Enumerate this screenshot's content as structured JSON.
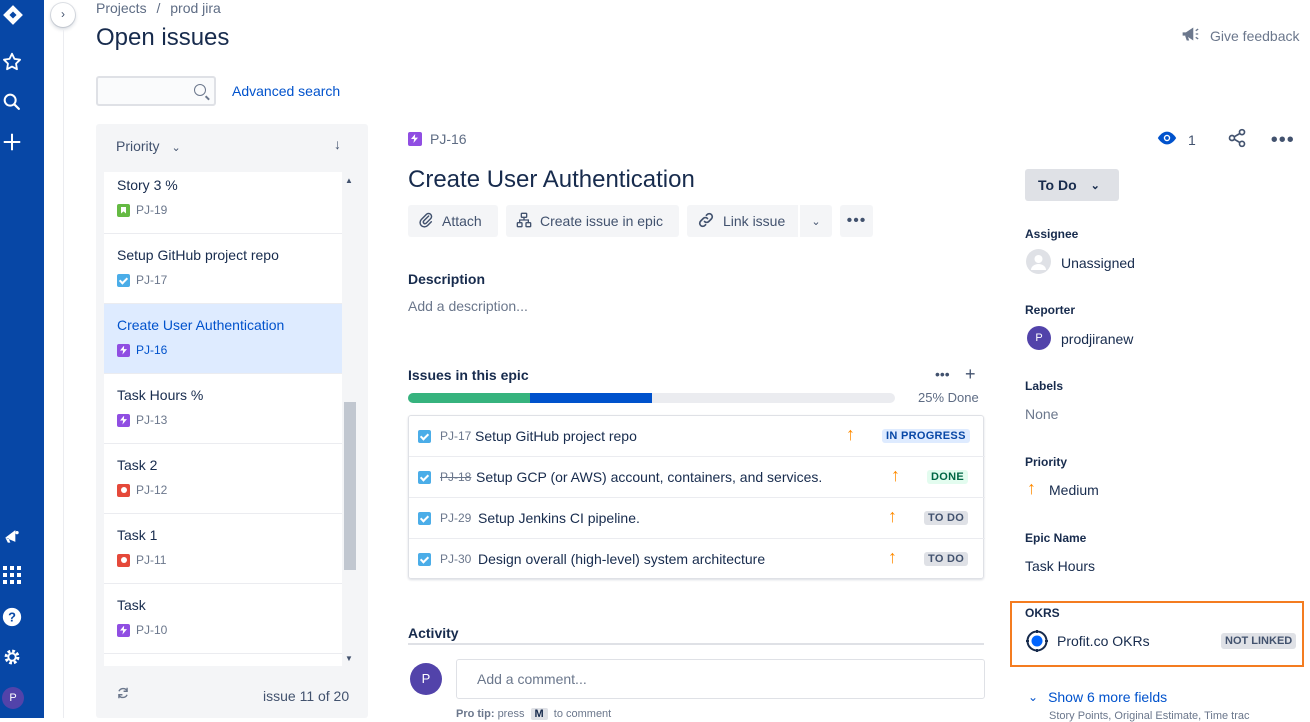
{
  "breadcrumb": {
    "projects": "Projects",
    "separator": "/",
    "project": "prod jira"
  },
  "page_title": "Open issues",
  "feedback_label": "Give feedback",
  "search": {
    "placeholder": "",
    "advanced_label": "Advanced search"
  },
  "list": {
    "sort_label": "Priority",
    "items": [
      {
        "title": "Story 3 %",
        "key": "PJ-19",
        "type": "story",
        "selected": false
      },
      {
        "title": "Setup GitHub project repo",
        "key": "PJ-17",
        "type": "task",
        "selected": false
      },
      {
        "title": "Create User Authentication",
        "key": "PJ-16",
        "type": "epic",
        "selected": true
      },
      {
        "title": "Task Hours %",
        "key": "PJ-13",
        "type": "epic",
        "selected": false
      },
      {
        "title": "Task 2",
        "key": "PJ-12",
        "type": "bug",
        "selected": false
      },
      {
        "title": "Task 1",
        "key": "PJ-11",
        "type": "bug",
        "selected": false
      },
      {
        "title": "Task",
        "key": "PJ-10",
        "type": "epic",
        "selected": false
      }
    ],
    "counter": "issue 11 of 20"
  },
  "issue": {
    "key": "PJ-16",
    "watchers": "1",
    "title": "Create User Authentication",
    "actions": {
      "attach": "Attach",
      "create_in_epic": "Create issue in epic",
      "link": "Link issue"
    },
    "description_heading": "Description",
    "description_placeholder": "Add a description...",
    "epic_heading": "Issues in this epic",
    "progress": {
      "done_pct": 0.25,
      "in_progress_pct": 0.25,
      "label": "25% Done"
    },
    "children": [
      {
        "key": "PJ-17",
        "summary": "Setup GitHub project repo",
        "status": "IN PROGRESS",
        "done": false
      },
      {
        "key": "PJ-18",
        "summary": "Setup GCP (or AWS) account, containers, and services.",
        "status": "DONE",
        "done": true
      },
      {
        "key": "PJ-29",
        "summary": "Setup Jenkins CI pipeline.",
        "status": "TO DO",
        "done": false
      },
      {
        "key": "PJ-30",
        "summary": "Design overall (high-level) system architecture",
        "status": "TO DO",
        "done": false
      }
    ],
    "activity_heading": "Activity",
    "comment_placeholder": "Add a comment...",
    "protip": {
      "prefix": "Pro tip:",
      "press": "press",
      "key": "M",
      "suffix": "to comment"
    }
  },
  "sidebar": {
    "status": "To Do",
    "assignee_label": "Assignee",
    "assignee": "Unassigned",
    "reporter_label": "Reporter",
    "reporter": "prodjiranew",
    "reporter_initial": "P",
    "labels_label": "Labels",
    "labels": "None",
    "priority_label": "Priority",
    "priority": "Medium",
    "epic_name_label": "Epic Name",
    "epic_name": "Task Hours",
    "okrs_label": "OKRS",
    "okrs_name": "Profit.co OKRs",
    "okrs_status": "NOT LINKED",
    "show_more": "Show 6 more fields",
    "more_fields": "Story Points, Original Estimate, Time trac"
  },
  "user_initial": "P",
  "colors": {
    "rail": "#0747a6",
    "accent": "#0052cc",
    "highlight": "#f47c20",
    "done": "#36b37e"
  }
}
